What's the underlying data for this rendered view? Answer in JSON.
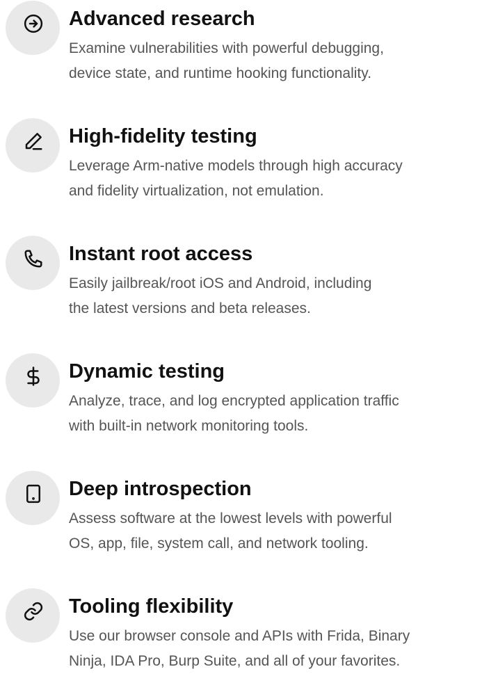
{
  "features": [
    {
      "icon": "arrow-circle-right-icon",
      "title": "Advanced research",
      "lines": [
        "Examine vulnerabilities with powerful debugging,",
        "device state, and runtime hooking functionality."
      ]
    },
    {
      "icon": "pencil-icon",
      "title": "High-fidelity testing",
      "lines": [
        "Leverage Arm-native models through high accuracy",
        "and fidelity virtualization, not emulation."
      ]
    },
    {
      "icon": "phone-icon",
      "title": "Instant root access",
      "lines": [
        "Easily jailbreak/root iOS and Android, including",
        "the latest versions and beta releases."
      ]
    },
    {
      "icon": "dollar-icon",
      "title": "Dynamic testing",
      "lines": [
        "Analyze, trace, and log encrypted application traffic",
        "with built-in network monitoring tools."
      ]
    },
    {
      "icon": "tablet-icon",
      "title": "Deep introspection",
      "lines": [
        "Assess software at the lowest levels with powerful",
        "OS, app, file, system call, and network tooling."
      ]
    },
    {
      "icon": "link-icon",
      "title": "Tooling flexibility",
      "lines": [
        "Use our browser console and APIs with Frida, Binary",
        "Ninja, IDA Pro, Burp Suite, and all of your favorites."
      ]
    }
  ]
}
